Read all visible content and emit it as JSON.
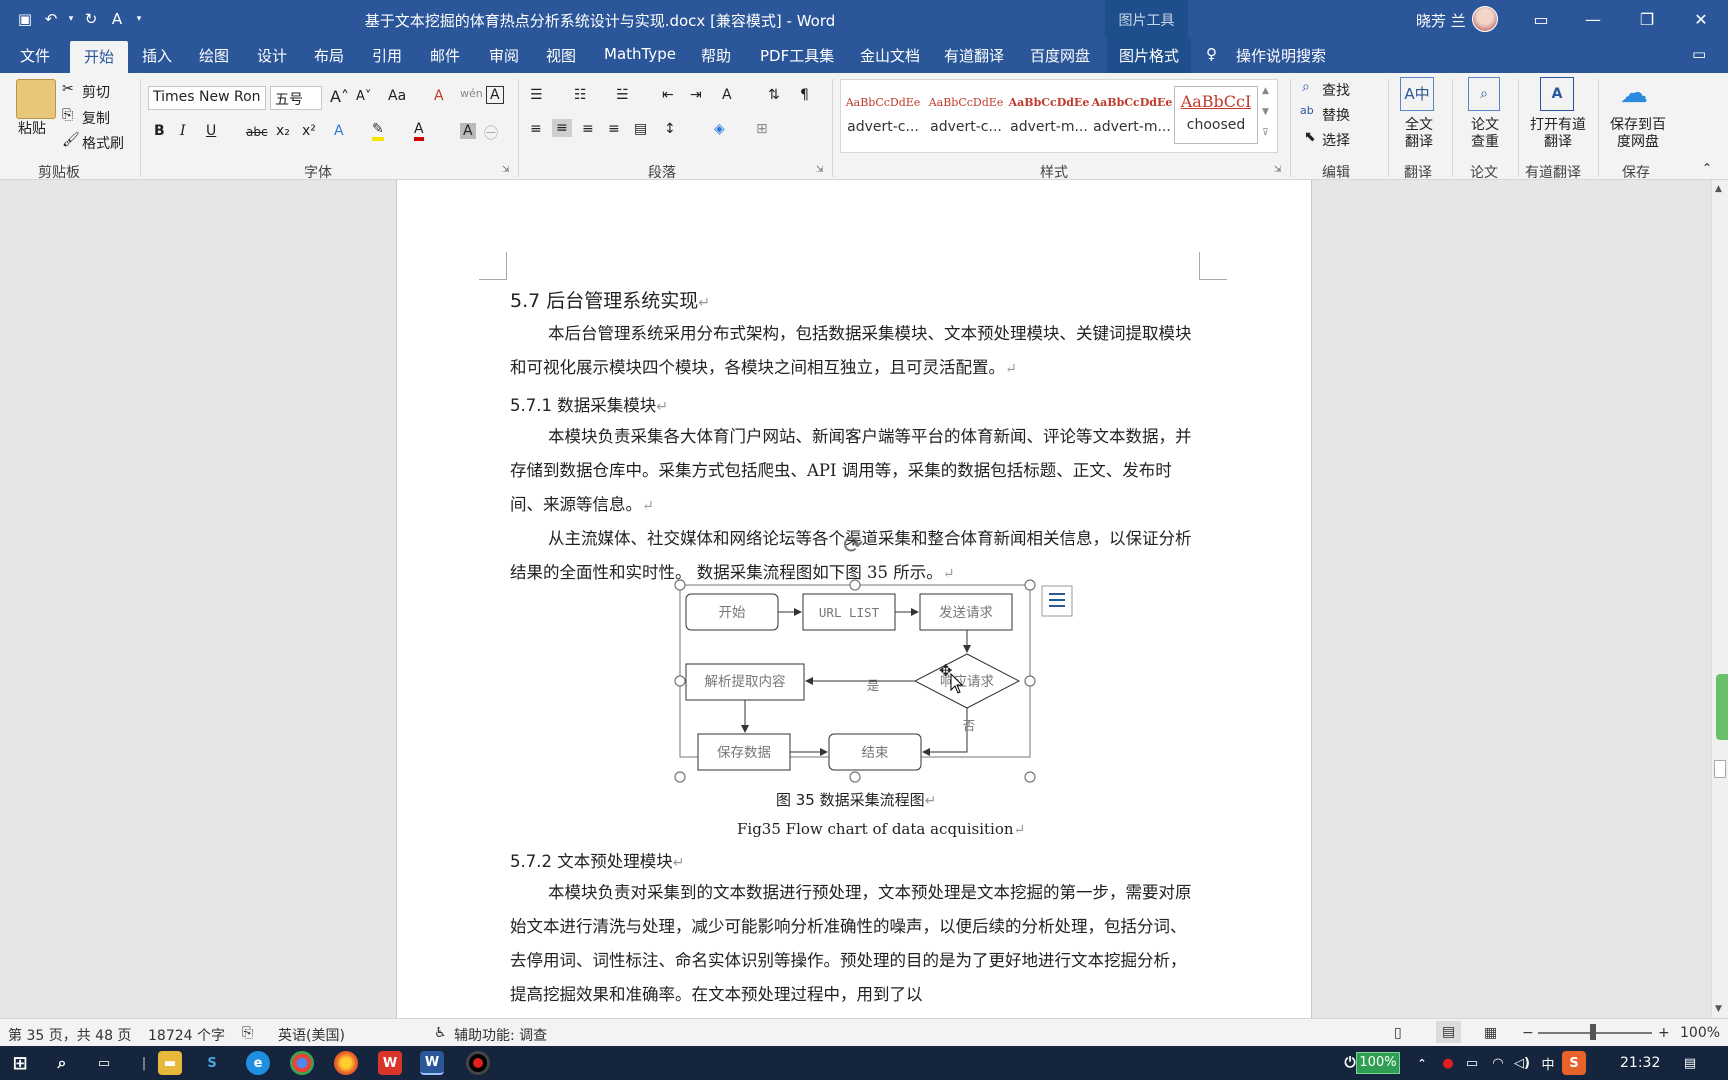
{
  "titlebar": {
    "title": "基于文本挖掘的体育热点分析系统设计与实现.docx [兼容模式] - Word",
    "picture_tools": "图片工具",
    "user": "晓芳 兰"
  },
  "tabs": [
    "文件",
    "开始",
    "插入",
    "绘图",
    "设计",
    "布局",
    "引用",
    "邮件",
    "审阅",
    "视图",
    "MathType",
    "帮助",
    "PDF工具集",
    "金山文档",
    "有道翻译",
    "百度网盘",
    "图片格式"
  ],
  "tell_me": "操作说明搜索",
  "ribbon": {
    "clipboard": {
      "paste": "粘贴",
      "cut": "剪切",
      "copy": "复制",
      "format_painter": "格式刷",
      "label": "剪贴板"
    },
    "font": {
      "name": "Times New Ron",
      "size": "五号",
      "label": "字体"
    },
    "paragraph": {
      "label": "段落"
    },
    "styles": {
      "label": "样式",
      "items": [
        {
          "preview": "AaBbCcDdEe",
          "name": "advert-c..."
        },
        {
          "preview": "AaBbCcDdEe",
          "name": "advert-c..."
        },
        {
          "preview": "AaBbCcDdEe",
          "name": "advert-m..."
        },
        {
          "preview": "AaBbCcDdEe",
          "name": "advert-m..."
        },
        {
          "preview": "AaBbCcI",
          "name": "choosed"
        }
      ]
    },
    "editing": {
      "find": "查找",
      "replace": "替换",
      "select": "选择",
      "label": "编辑"
    },
    "translate": {
      "full": "全文翻译",
      "label": "翻译"
    },
    "thesis": {
      "check": "论文查重",
      "label": "论文"
    },
    "youdao": {
      "open": "打开有道翻译",
      "label": "有道翻译"
    },
    "save": {
      "save_to": "保存到百度网盘",
      "label": "保存"
    }
  },
  "doc": {
    "h57": "5.7 后台管理系统实现",
    "p1": "本后台管理系统采用分布式架构，包括数据采集模块、文本预处理模块、关键词提取模块和可视化展示模块四个模块，各模块之间相互独立，且可灵活配置。",
    "h571": "5.7.1  数据采集模块",
    "p2": "本模块负责采集各大体育门户网站、新闻客户端等平台的体育新闻、评论等文本数据，并存储到数据仓库中。采集方式包括爬虫、API 调用等，采集的数据包括标题、正文、发布时间、来源等信息。",
    "p3": "从主流媒体、社交媒体和网络论坛等各个渠道采集和整合体育新闻相关信息，以保证分析结果的全面性和实时性。  数据采集流程图如下图 35 所示。",
    "flow": {
      "start": "开始",
      "url_list": "URL LIST",
      "send": "发送请求",
      "check": "响应请求",
      "parse": "解析提取内容",
      "yes": "是",
      "no": "否",
      "save": "保存数据",
      "end": "结束"
    },
    "caption_cn": "图 35  数据采集流程图",
    "caption_en": "Fig35 Flow chart of data acquisition",
    "h572": "5.7.2  文本预处理模块",
    "p4": "本模块负责对采集到的文本数据进行预处理，文本预处理是文本挖掘的第一步，需要对原始文本进行清洗与处理，减少可能影响分析准确性的噪声，以便后续的分析处理，包括分词、去停用词、词性标注、命名实体识别等操作。预处理的目的是为了更好地进行文本挖掘分析，提高挖掘效果和准确率。在文本预处理过程中，用到了以"
  },
  "status": {
    "page": "第 35 页，共 48 页",
    "words": "18724 个字",
    "lang": "英语(美国)",
    "access": "辅助功能: 调查",
    "zoom": "100%"
  },
  "taskbar": {
    "battery": "100%",
    "ime": "中",
    "time": "21:32"
  }
}
